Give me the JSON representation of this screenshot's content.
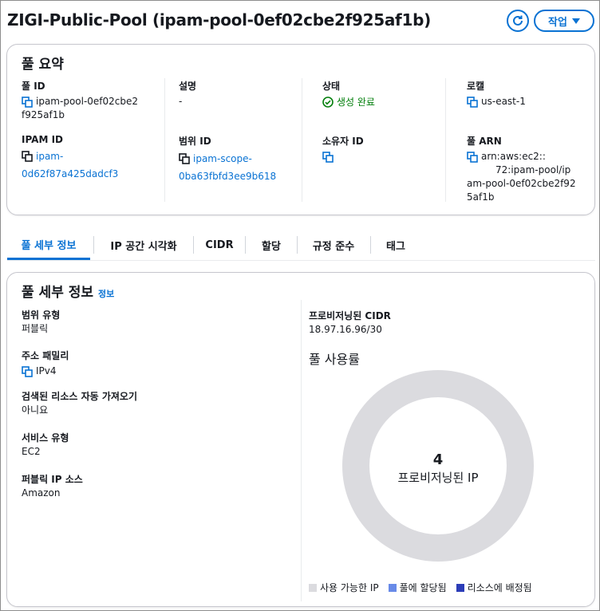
{
  "header": {
    "title": "ZIGI-Public-Pool (ipam-pool-0ef02cbe2f925af1b)",
    "action_label": "작업"
  },
  "summary": {
    "title": "풀 요약",
    "pool_id": {
      "label": "풀 ID",
      "value_line1": "ipam-pool-0ef02cbe2",
      "value_line2": "f925af1b"
    },
    "description": {
      "label": "설명",
      "value": "-"
    },
    "status": {
      "label": "상태",
      "value": "생성 완료"
    },
    "locale": {
      "label": "로캘",
      "value": "us-east-1"
    },
    "ipam_id": {
      "label": "IPAM ID",
      "value_line1": "ipam-",
      "value_line2": "0d62f87a425dadcf3"
    },
    "scope_id": {
      "label": "범위 ID",
      "value_line1": "ipam-scope-",
      "value_line2": "0ba63fbfd3ee9b618"
    },
    "owner_id": {
      "label": "소유자 ID"
    },
    "pool_arn": {
      "label": "풀 ARN",
      "value_line1": "arn:aws:ec2::",
      "value_line2": "72:ipam-pool/ip",
      "value_line3": "am-pool-0ef02cbe2f92",
      "value_line4": "5af1b"
    }
  },
  "tabs": [
    {
      "label": "풀 세부 정보"
    },
    {
      "label": "IP 공간 시각화"
    },
    {
      "label": "CIDR"
    },
    {
      "label": "할당"
    },
    {
      "label": "규정 준수"
    },
    {
      "label": "태그"
    }
  ],
  "details": {
    "title": "풀 세부 정보",
    "info_link": "정보",
    "scope_type": {
      "label": "범위 유형",
      "value": "퍼블릭"
    },
    "address_family": {
      "label": "주소 패밀리",
      "value": "IPv4"
    },
    "auto_import": {
      "label": "검색된 리소스 자동 가져오기",
      "value": "아니요"
    },
    "service_type": {
      "label": "서비스 유형",
      "value": "EC2"
    },
    "public_ip_source": {
      "label": "퍼블릭 IP 소스",
      "value": "Amazon"
    },
    "provisioned_cidr": {
      "label": "프로비저닝된 CIDR",
      "value": "18.97.16.96/30"
    },
    "usage": {
      "label": "풀 사용률",
      "center_value": "4",
      "center_label": "프로비저닝된 IP",
      "legend": [
        {
          "name": "사용 가능한 IP",
          "color": "#dbdbdf"
        },
        {
          "name": "풀에 할당됨",
          "color": "#688ae8"
        },
        {
          "name": "리소스에 배정됨",
          "color": "#2c3db8"
        }
      ]
    }
  },
  "colors": {
    "accent": "#0972d3",
    "success": "#037f0c",
    "ring": "#dbdbdf"
  }
}
